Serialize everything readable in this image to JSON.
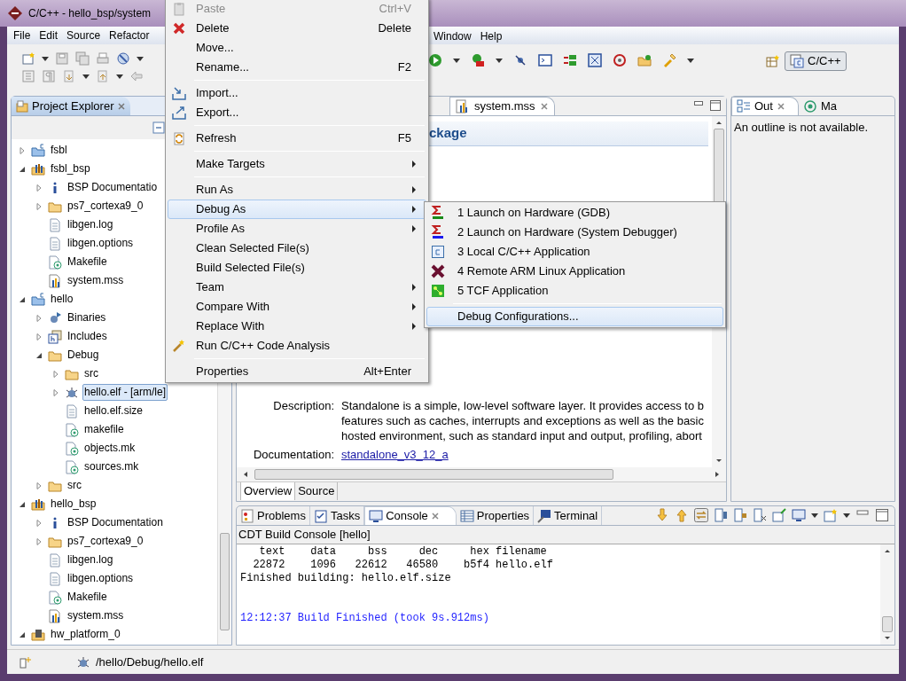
{
  "window": {
    "title": "C/C++ - hello_bsp/system"
  },
  "menu_bar": [
    {
      "label": "File"
    },
    {
      "label": "Edit"
    },
    {
      "label": "Source"
    },
    {
      "label": "Refactor"
    },
    {
      "label": "Window"
    },
    {
      "label": "Help"
    }
  ],
  "perspective": {
    "label": "C/C++",
    "selected": true
  },
  "project_explorer": {
    "tab": "Project Explorer",
    "tree": [
      {
        "label": "fsbl",
        "kind": "cproject",
        "expanded": false,
        "selected": false
      },
      {
        "label": "fsbl_bsp",
        "kind": "bsp",
        "expanded": true,
        "selected": false,
        "children": [
          {
            "label": "BSP Documentatio",
            "kind": "info",
            "expanded": false,
            "selected": false
          },
          {
            "label": "ps7_cortexa9_0",
            "kind": "folder",
            "expanded": false,
            "selected": false
          },
          {
            "label": "libgen.log",
            "kind": "file",
            "selected": false
          },
          {
            "label": "libgen.options",
            "kind": "file",
            "selected": false
          },
          {
            "label": "Makefile",
            "kind": "make",
            "selected": false
          },
          {
            "label": "system.mss",
            "kind": "mss",
            "selected": false
          }
        ]
      },
      {
        "label": "hello",
        "kind": "cproject",
        "expanded": true,
        "selected": false,
        "children": [
          {
            "label": "Binaries",
            "kind": "binaries",
            "expanded": false,
            "selected": false
          },
          {
            "label": "Includes",
            "kind": "includes",
            "expanded": false,
            "selected": false
          },
          {
            "label": "Debug",
            "kind": "folder",
            "expanded": true,
            "selected": false,
            "children": [
              {
                "label": "src",
                "kind": "folder",
                "expanded": false,
                "selected": false
              },
              {
                "label": "hello.elf - [arm/le]",
                "kind": "elf",
                "expanded": false,
                "selected": true
              },
              {
                "label": "hello.elf.size",
                "kind": "file",
                "selected": false
              },
              {
                "label": "makefile",
                "kind": "make",
                "selected": false
              },
              {
                "label": "objects.mk",
                "kind": "make",
                "selected": false
              },
              {
                "label": "sources.mk",
                "kind": "make",
                "selected": false
              }
            ]
          },
          {
            "label": "src",
            "kind": "folder",
            "expanded": false,
            "selected": false
          }
        ]
      },
      {
        "label": "hello_bsp",
        "kind": "bsp",
        "expanded": true,
        "selected": false,
        "children": [
          {
            "label": "BSP Documentation",
            "kind": "info",
            "expanded": false,
            "selected": false
          },
          {
            "label": "ps7_cortexa9_0",
            "kind": "folder",
            "expanded": false,
            "selected": false
          },
          {
            "label": "libgen.log",
            "kind": "file",
            "selected": false
          },
          {
            "label": "libgen.options",
            "kind": "file",
            "selected": false
          },
          {
            "label": "Makefile",
            "kind": "make",
            "selected": false
          },
          {
            "label": "system.mss",
            "kind": "mss",
            "selected": false
          }
        ]
      },
      {
        "label": "hw_platform_0",
        "kind": "hw",
        "expanded": true,
        "selected": false
      }
    ]
  },
  "editor": {
    "tab": "system.mss",
    "heading": "ckage",
    "fields": [
      {
        "label": "Description:",
        "lines": [
          "Standalone is a simple, low-level software layer. It provides access to b",
          "features such as caches, interrupts and exceptions as well as the basic",
          "hosted environment, such as standard input and output, profiling, abort"
        ]
      },
      {
        "label": "Documentation:",
        "link": "standalone_v3_12_a"
      }
    ],
    "bottom_tabs": [
      {
        "label": "Overview",
        "selected": true
      },
      {
        "label": "Source",
        "selected": false
      }
    ]
  },
  "outline": {
    "tabs": [
      {
        "label": "Out",
        "selected": true
      },
      {
        "label": "Ma",
        "selected": false
      }
    ],
    "message": "An outline is not available."
  },
  "console": {
    "tabs": [
      {
        "label": "Problems",
        "selected": false
      },
      {
        "label": "Tasks",
        "selected": false
      },
      {
        "label": "Console",
        "selected": true
      },
      {
        "label": "Properties",
        "selected": false
      },
      {
        "label": "Terminal",
        "selected": false
      }
    ],
    "title": "CDT Build Console [hello]",
    "lines": [
      {
        "text": "   text    data     bss     dec     hex filename",
        "kind": "output"
      },
      {
        "text": "  22872    1096   22612   46580    b5f4 hello.elf",
        "kind": "output"
      },
      {
        "text": "Finished building: hello.elf.size",
        "kind": "output"
      },
      {
        "text": "12:12:37 Build Finished (took 9s.912ms)",
        "kind": "info"
      }
    ]
  },
  "status_bar": {
    "path": "/hello/Debug/hello.elf"
  },
  "context_menu": [
    {
      "kind": "item",
      "label": "Paste",
      "shortcut": "Ctrl+V",
      "disabled": true,
      "selected": false,
      "submenu": false
    },
    {
      "kind": "item",
      "label": "Delete",
      "shortcut": "Delete",
      "disabled": false,
      "selected": false,
      "submenu": false
    },
    {
      "kind": "item",
      "label": "Move...",
      "disabled": false,
      "selected": false,
      "submenu": false
    },
    {
      "kind": "item",
      "label": "Rename...",
      "shortcut": "F2",
      "disabled": false,
      "selected": false,
      "submenu": false
    },
    {
      "kind": "separator"
    },
    {
      "kind": "item",
      "label": "Import...",
      "disabled": false,
      "selected": false,
      "submenu": false
    },
    {
      "kind": "item",
      "label": "Export...",
      "disabled": false,
      "selected": false,
      "submenu": false
    },
    {
      "kind": "separator"
    },
    {
      "kind": "item",
      "label": "Refresh",
      "shortcut": "F5",
      "disabled": false,
      "selected": false,
      "submenu": false
    },
    {
      "kind": "separator"
    },
    {
      "kind": "item",
      "label": "Make Targets",
      "disabled": false,
      "selected": false,
      "submenu": true
    },
    {
      "kind": "separator"
    },
    {
      "kind": "item",
      "label": "Run As",
      "disabled": false,
      "selected": false,
      "submenu": true
    },
    {
      "kind": "item",
      "label": "Debug As",
      "disabled": false,
      "selected": true,
      "submenu": true
    },
    {
      "kind": "item",
      "label": "Profile As",
      "disabled": false,
      "selected": false,
      "submenu": true
    },
    {
      "kind": "item",
      "label": "Clean Selected File(s)",
      "disabled": false,
      "selected": false,
      "submenu": false
    },
    {
      "kind": "item",
      "label": "Build Selected File(s)",
      "disabled": false,
      "selected": false,
      "submenu": false
    },
    {
      "kind": "item",
      "label": "Team",
      "disabled": false,
      "selected": false,
      "submenu": true
    },
    {
      "kind": "item",
      "label": "Compare With",
      "disabled": false,
      "selected": false,
      "submenu": true
    },
    {
      "kind": "item",
      "label": "Replace With",
      "disabled": false,
      "selected": false,
      "submenu": true
    },
    {
      "kind": "item",
      "label": "Run C/C++ Code Analysis",
      "disabled": false,
      "selected": false,
      "submenu": false
    },
    {
      "kind": "separator"
    },
    {
      "kind": "item",
      "label": "Properties",
      "shortcut": "Alt+Enter",
      "disabled": false,
      "selected": false,
      "submenu": false
    }
  ],
  "debug_submenu": [
    {
      "kind": "item",
      "label": "1 Launch on Hardware (GDB)",
      "selected": false
    },
    {
      "kind": "item",
      "label": "2 Launch on Hardware (System Debugger)",
      "selected": false
    },
    {
      "kind": "item",
      "label": "3 Local C/C++ Application",
      "selected": false
    },
    {
      "kind": "item",
      "label": "4 Remote ARM Linux Application",
      "selected": false
    },
    {
      "kind": "item",
      "label": "5 TCF Application",
      "selected": false
    },
    {
      "kind": "separator"
    },
    {
      "kind": "item",
      "label": "Debug Configurations...",
      "selected": true
    }
  ]
}
